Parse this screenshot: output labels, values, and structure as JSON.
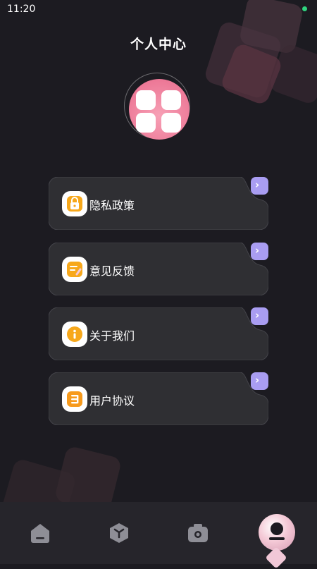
{
  "status_bar": {
    "time": "11:20"
  },
  "header": {
    "title": "个人中心"
  },
  "menu": {
    "items": [
      {
        "label": "隐私政策",
        "icon": "lock-icon"
      },
      {
        "label": "意见反馈",
        "icon": "note-edit-icon"
      },
      {
        "label": "关于我们",
        "icon": "info-icon"
      },
      {
        "label": "用户协议",
        "icon": "list-icon"
      }
    ]
  },
  "bottom_nav": {
    "items": [
      {
        "name": "home",
        "icon": "home-icon"
      },
      {
        "name": "cube",
        "icon": "cube-icon"
      },
      {
        "name": "camera",
        "icon": "camera-icon"
      },
      {
        "name": "profile",
        "icon": "user-icon",
        "active": true
      }
    ]
  },
  "colors": {
    "background": "#1c1b21",
    "card": "#2f2f33",
    "accent_purple": "#a99df2",
    "avatar_pink": "#ee7a98",
    "icon_orange": "#f79a1c"
  }
}
